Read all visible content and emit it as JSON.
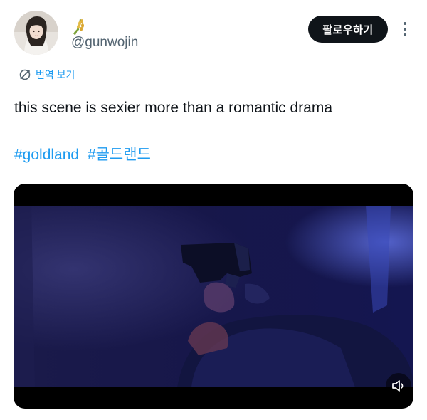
{
  "header": {
    "handle": "@gunwojin",
    "follow_label": "팔로우하기",
    "avatar_icon": "profile-photo",
    "name_icon": "rice-emoji-icon",
    "more_icon": "more-vertical-icon"
  },
  "translate": {
    "label": "번역 보기",
    "icon": "translate-icon"
  },
  "tweet": {
    "text": "this scene is sexier more than a romantic drama",
    "hashtags": [
      "#goldland",
      "#골드랜드"
    ]
  },
  "media": {
    "type": "video",
    "volume_icon": "speaker-muted-icon"
  },
  "colors": {
    "accent": "#1d9bf0",
    "text": "#0f1419",
    "secondary": "#536471",
    "button_bg": "#0f1419"
  }
}
